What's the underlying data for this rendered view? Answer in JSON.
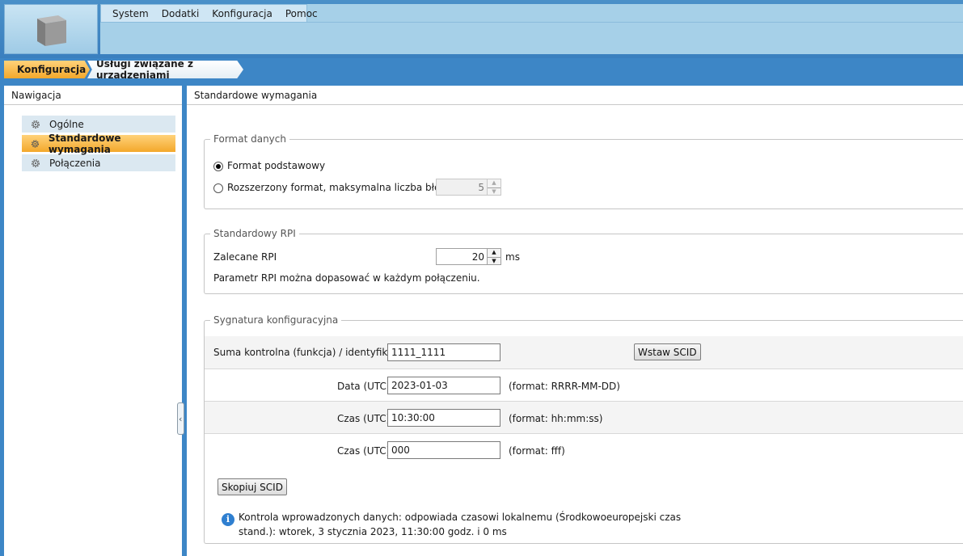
{
  "menu": {
    "items": [
      "System",
      "Dodatki",
      "Konfiguracja",
      "Pomoc"
    ]
  },
  "breadcrumb": {
    "root": "Konfiguracja",
    "current": "Usługi związane z urządzeniami"
  },
  "navigation": {
    "title": "Nawigacja",
    "items": [
      {
        "label": "Ogólne",
        "icon": "gear-icon"
      },
      {
        "label": "Standardowe wymagania",
        "icon": "gear-icon"
      },
      {
        "label": "Połączenia",
        "icon": "gear-icon"
      }
    ]
  },
  "main": {
    "title": "Standardowe wymagania",
    "format_danych": {
      "title": "Format danych",
      "basic_label": "Format podstawowy",
      "extended_label": "Rozszerzony format, maksymalna liczba błędów",
      "max_errors": "5"
    },
    "rpi": {
      "title": "Standardowy RPI",
      "label": "Zalecane RPI",
      "value": "20",
      "unit": "ms",
      "note": "Parametr RPI można dopasować w każdym połączeniu."
    },
    "signature": {
      "title": "Sygnatura konfiguracyjna",
      "checksum_label": "Suma kontrolna (funkcja) / identyfikator",
      "checksum_value": "1111_1111",
      "insert_button": "Wstaw SCID",
      "date_label": "Data (UTC)",
      "date_value": "2023-01-03",
      "date_hint": "(format: RRRR-MM-DD)",
      "time_label": "Czas (UTC)",
      "time_value": "10:30:00",
      "time_hint": "(format: hh:mm:ss)",
      "ms_label": "Czas (UTC)",
      "ms_value": "000",
      "ms_hint": "(format: fff)",
      "copy_button": "Skopiuj SCID",
      "info_line1": "Kontrola wprowadzonych danych: odpowiada czasowi lokalnemu (Środkowoeuropejski czas",
      "info_line2": "stand.): wtorek, 3 stycznia 2023, 11:30:00 godz. i 0 ms"
    }
  },
  "colors": {
    "accent_orange": "#f3a82b",
    "header_blue": "#3d86c6",
    "info_blue": "#2f7fd0"
  }
}
